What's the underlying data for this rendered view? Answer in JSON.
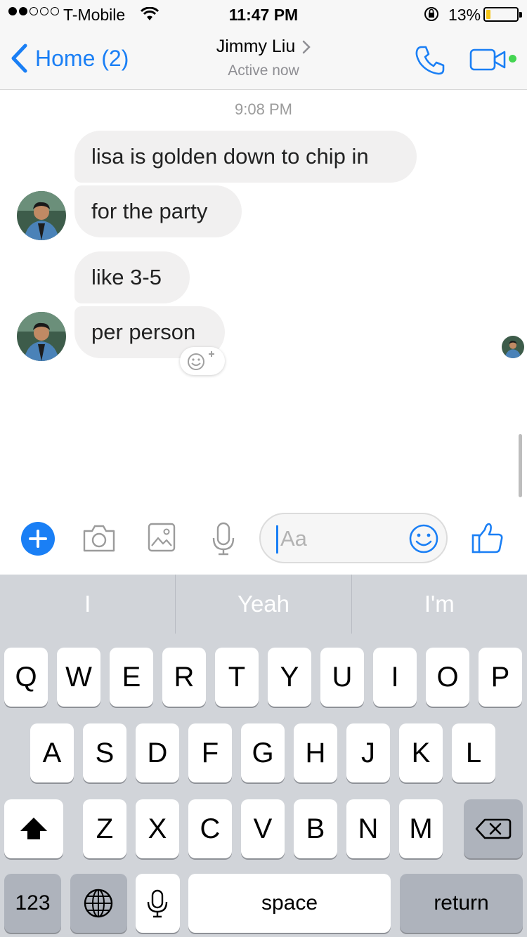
{
  "status_bar": {
    "carrier": "T-Mobile",
    "time": "11:47 PM",
    "battery_percent": "13%",
    "battery_level": 0.13,
    "signal_bars_filled": 2,
    "signal_bars_total": 5
  },
  "nav": {
    "back_label": "Home (2)",
    "contact_name": "Jimmy Liu",
    "presence": "Active now",
    "accent_color": "#1a7ff5",
    "online_color": "#44d552"
  },
  "chat": {
    "timestamp": "9:08 PM",
    "messages": [
      {
        "text": "lisa is golden down to chip in"
      },
      {
        "text": "for the party"
      },
      {
        "text": "like 3-5"
      },
      {
        "text": "per person"
      }
    ]
  },
  "composer": {
    "placeholder": "Aa"
  },
  "keyboard": {
    "suggestions": [
      "I",
      "Yeah",
      "I'm"
    ],
    "row1": [
      "Q",
      "W",
      "E",
      "R",
      "T",
      "Y",
      "U",
      "I",
      "O",
      "P"
    ],
    "row2": [
      "A",
      "S",
      "D",
      "F",
      "G",
      "H",
      "J",
      "K",
      "L"
    ],
    "row3": [
      "Z",
      "X",
      "C",
      "V",
      "B",
      "N",
      "M"
    ],
    "numbers_label": "123",
    "space_label": "space",
    "return_label": "return"
  }
}
